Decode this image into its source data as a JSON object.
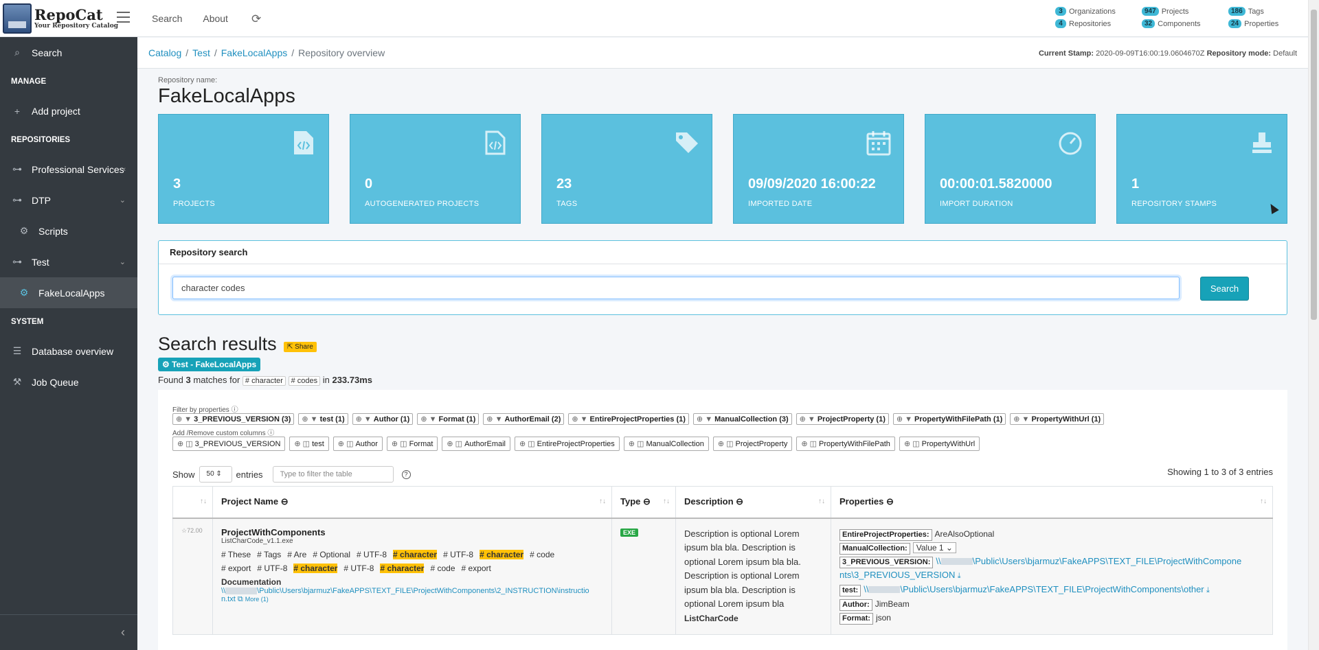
{
  "brand": {
    "name": "RepoCat",
    "tagline": "Your Repository Catalog"
  },
  "topnav": {
    "search": "Search",
    "about": "About"
  },
  "stats": [
    {
      "count": "3",
      "label": "Organizations"
    },
    {
      "count": "947",
      "label": "Projects"
    },
    {
      "count": "186",
      "label": "Tags"
    },
    {
      "count": "4",
      "label": "Repositories"
    },
    {
      "count": "32",
      "label": "Components"
    },
    {
      "count": "24",
      "label": "Properties"
    }
  ],
  "sidebar": {
    "search": "Search",
    "manage_header": "MANAGE",
    "add_project": "Add project",
    "repos_header": "REPOSITORIES",
    "professional_services": "Professional Services",
    "dtp": "DTP",
    "scripts": "Scripts",
    "test": "Test",
    "fake_local_apps": "FakeLocalApps",
    "system_header": "SYSTEM",
    "database_overview": "Database overview",
    "job_queue": "Job Queue"
  },
  "breadcrumb": {
    "catalog": "Catalog",
    "test": "Test",
    "repo": "FakeLocalApps",
    "current": "Repository overview"
  },
  "stamp": {
    "label": "Current Stamp:",
    "value": "2020-09-09T16:00:19.0604670Z",
    "mode_label": "Repository mode:",
    "mode": "Default"
  },
  "repo": {
    "label": "Repository name:",
    "name": "FakeLocalApps"
  },
  "boxes": [
    {
      "value": "3",
      "label": "PROJECTS",
      "icon": "file-code-icon"
    },
    {
      "value": "0",
      "label": "AUTOGENERATED PROJECTS",
      "icon": "file-code-outline-icon"
    },
    {
      "value": "23",
      "label": "TAGS",
      "icon": "tag-icon"
    },
    {
      "value": "09/09/2020 16:00:22",
      "label": "IMPORTED DATE",
      "icon": "calendar-icon"
    },
    {
      "value": "00:00:01.5820000",
      "label": "IMPORT DURATION",
      "icon": "stopwatch-icon"
    },
    {
      "value": "1",
      "label": "REPOSITORY STAMPS",
      "icon": "stamp-icon"
    }
  ],
  "search": {
    "title": "Repository search",
    "query": "character codes",
    "button": "Search"
  },
  "results": {
    "title": "Search results",
    "share": "Share",
    "scope": "Test - FakeLocalApps",
    "found_prefix": "Found",
    "found_count": "3",
    "found_mid": "matches for",
    "tag1": "# character",
    "tag2": "# codes",
    "found_in": "in",
    "time": "233.73ms"
  },
  "filters": {
    "label": "Filter by properties",
    "items": [
      "3_PREVIOUS_VERSION (3)",
      "test (1)",
      "Author (1)",
      "Format (1)",
      "AuthorEmail (2)",
      "EntireProjectProperties (1)",
      "ManualCollection (3)",
      "ProjectProperty (1)",
      "PropertyWithFilePath (1)",
      "PropertyWithUrl (1)"
    ]
  },
  "columns": {
    "label": "Add /Remove custom columns",
    "items": [
      "3_PREVIOUS_VERSION",
      "test",
      "Author",
      "Format",
      "AuthorEmail",
      "EntireProjectProperties",
      "ManualCollection",
      "ProjectProperty",
      "PropertyWithFilePath",
      "PropertyWithUrl"
    ]
  },
  "table_controls": {
    "show": "Show",
    "page_size": "50",
    "entries": "entries",
    "filter_placeholder": "Type to filter the table",
    "showing": "Showing 1 to 3 of 3 entries"
  },
  "table": {
    "headers": [
      "Project Name",
      "Type",
      "Description",
      "Properties"
    ],
    "row": {
      "rating": "☆72.00",
      "name": "ProjectWithComponents",
      "file": "ListCharCode_v1.1.exe",
      "tags_line1": [
        "# These",
        "# Tags",
        "# Are",
        "# Optional",
        "# UTF-8",
        "# character",
        "# UTF-8",
        "# character",
        "# code"
      ],
      "tags_line2": [
        "# export",
        "# UTF-8",
        "# character",
        "# UTF-8",
        "# character",
        "# code",
        "# export"
      ],
      "doc_header": "Documentation",
      "doc_link_a": "\\\\",
      "doc_link_b": "\\Public\\Users\\bjarmuz\\FakeAPPS\\TEXT_FILE\\ProjectWithComponents\\2_INSTRUCTION\\instructio",
      "doc_link_c": "n.txt",
      "doc_more": "More (1)",
      "type": "EXE",
      "description": "Description is optional Lorem ipsum bla bla. Description is optional Lorem ipsum bla bla. Description is optional Lorem ipsum bla bla. Description is optional Lorem ipsum bla",
      "desc_more": "ListCharCode",
      "props": {
        "p1_key": "EntireProjectProperties:",
        "p1_val": "AreAlsoOptional",
        "p2_key": "ManualCollection:",
        "p2_val": "Value 1",
        "p3_key": "3_PREVIOUS_VERSION:",
        "p3_a": "\\\\",
        "p3_b": "\\Public\\Users\\bjarmuz\\FakeAPPS\\TEXT_FILE\\ProjectWithCompone",
        "p3_c": "nts\\3_PREVIOUS_VERSION",
        "p4_key": "test:",
        "p4_a": "\\\\",
        "p4_b": "\\Public\\Users\\bjarmuz\\FakeAPPS\\TEXT_FILE\\ProjectWithComponents\\other",
        "p5_key": "Author:",
        "p5_val": "JimBeam",
        "p6_key": "Format:",
        "p6_val": "json"
      }
    }
  },
  "colors": {
    "sidebar": "#343a40",
    "info": "#5bc0de",
    "accent": "#17a2b8",
    "highlight": "#ffc107"
  }
}
